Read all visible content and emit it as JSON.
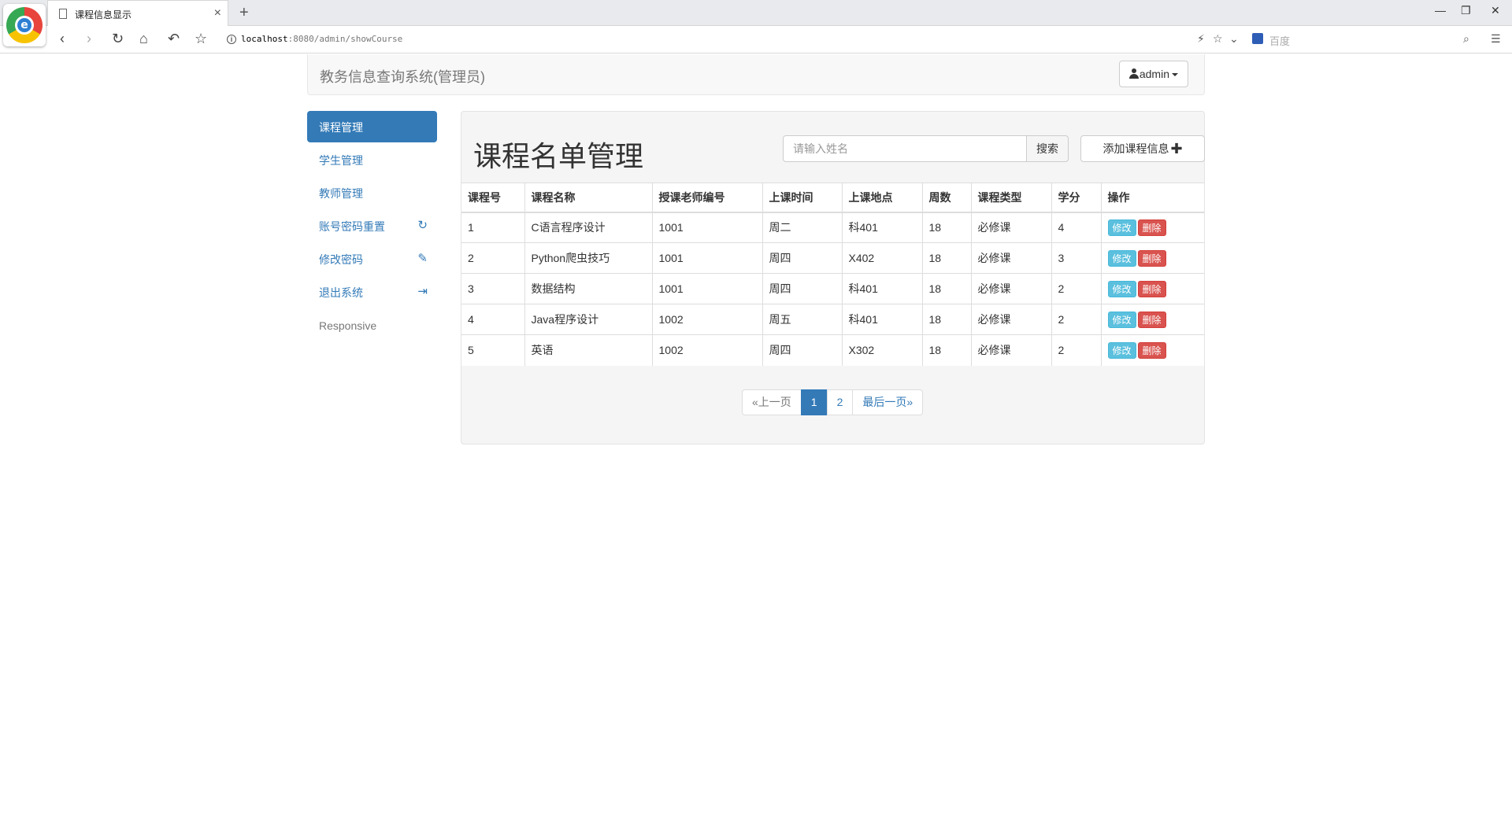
{
  "browser": {
    "tab_title": "课程信息显示",
    "tab_close": "×",
    "new_tab": "+",
    "url_host": "localhost",
    "url_rest": ":8080/admin/showCourse",
    "search_placeholder": "百度",
    "logo_letter": "e"
  },
  "navbar": {
    "brand": "教务信息查询系统(管理员)",
    "user_label": "admin"
  },
  "sidebar": {
    "items": [
      {
        "label": "课程管理"
      },
      {
        "label": "学生管理"
      },
      {
        "label": "教师管理"
      },
      {
        "label": "账号密码重置",
        "icon": "↻"
      },
      {
        "label": "修改密码",
        "icon": "✎"
      },
      {
        "label": "退出系统",
        "icon": "⇥"
      },
      {
        "label": "Responsive"
      }
    ]
  },
  "panel": {
    "title": "课程名单管理",
    "search_placeholder": "请输入姓名",
    "search_button": "搜索",
    "add_button": "添加课程信息",
    "add_icon": "✚"
  },
  "table": {
    "headers": [
      "课程号",
      "课程名称",
      "授课老师编号",
      "上课时间",
      "上课地点",
      "周数",
      "课程类型",
      "学分",
      "操作"
    ],
    "edit_label": "修改",
    "delete_label": "删除",
    "rows": [
      [
        "1",
        "C语言程序设计",
        "1001",
        "周二",
        "科401",
        "18",
        "必修课",
        "4"
      ],
      [
        "2",
        "Python爬虫技巧",
        "1001",
        "周四",
        "X402",
        "18",
        "必修课",
        "3"
      ],
      [
        "3",
        "数据结构",
        "1001",
        "周四",
        "科401",
        "18",
        "必修课",
        "2"
      ],
      [
        "4",
        "Java程序设计",
        "1002",
        "周五",
        "科401",
        "18",
        "必修课",
        "2"
      ],
      [
        "5",
        "英语",
        "1002",
        "周四",
        "X302",
        "18",
        "必修课",
        "2"
      ]
    ]
  },
  "pagination": {
    "prev": "«上一页",
    "pages": [
      "1",
      "2"
    ],
    "last": "最后一页»"
  },
  "colors": {
    "primary": "#337ab7",
    "info": "#5bc0de",
    "danger": "#d9534f"
  }
}
